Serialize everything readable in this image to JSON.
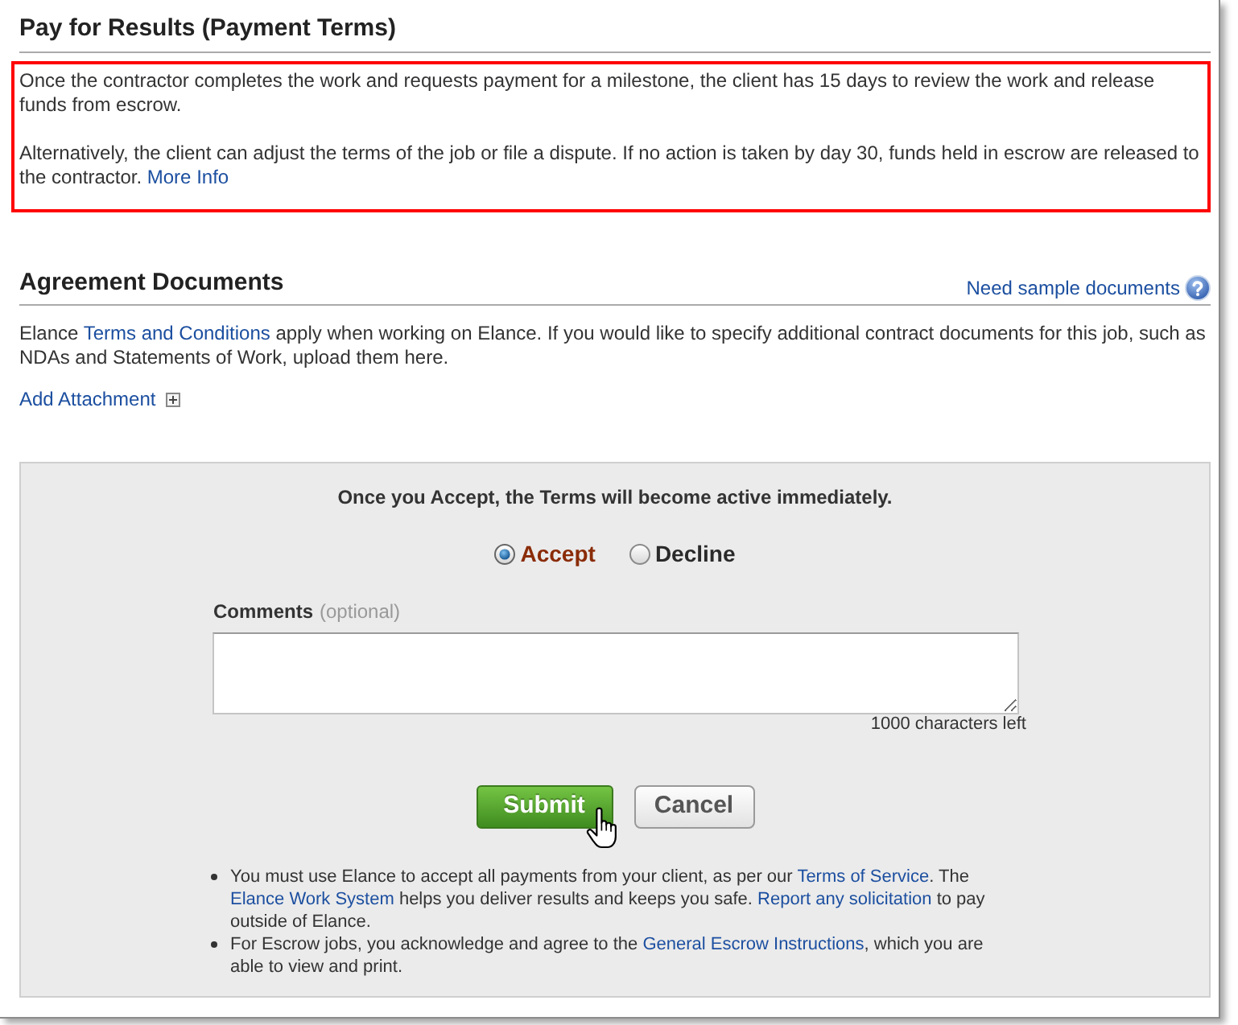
{
  "payment_terms": {
    "title": "Pay for Results (Payment Terms)",
    "paragraphs": [
      [
        {
          "kind": "text",
          "text": "Once the contractor completes the work and requests payment for a milestone, the client has 15 days to review the work and release funds from escrow."
        }
      ],
      [
        {
          "kind": "text",
          "text": "Alternatively, the client can adjust the terms of the job or file a dispute. If no action is taken by day 30, funds held in escrow are released to the contractor. "
        },
        {
          "kind": "link",
          "text": "More Info"
        }
      ]
    ]
  },
  "agreement_documents": {
    "title": "Agreement Documents",
    "help_link": "Need sample documents",
    "paragraph": [
      {
        "kind": "text",
        "text": "Elance "
      },
      {
        "kind": "link",
        "text": "Terms and Conditions"
      },
      {
        "kind": "text",
        "text": " apply when working on Elance. If you would like to specify additional contract documents for this job, such as NDAs and Statements of Work, upload them here."
      }
    ],
    "add_attachment": "Add Attachment"
  },
  "acceptance": {
    "notice": "Once you Accept, the Terms will become active immediately.",
    "choices": [
      {
        "label": "Accept",
        "selected": true
      },
      {
        "label": "Decline",
        "selected": false
      }
    ],
    "comments": {
      "label": "Comments",
      "hint": "(optional)",
      "counter": "1000 characters left"
    },
    "buttons": [
      {
        "label": "Submit",
        "kind": "primary"
      },
      {
        "label": "Cancel",
        "kind": "secondary"
      }
    ],
    "notes": [
      [
        {
          "kind": "text",
          "text": "You must use Elance to accept all payments from your client, as per our "
        },
        {
          "kind": "link",
          "text": "Terms of Service"
        },
        {
          "kind": "text",
          "text": ". The "
        },
        {
          "kind": "link",
          "text": "Elance Work System"
        },
        {
          "kind": "text",
          "text": " helps you deliver results and keeps you safe. "
        },
        {
          "kind": "link",
          "text": "Report any solicitation"
        },
        {
          "kind": "text",
          "text": " to pay outside of Elance."
        }
      ],
      [
        {
          "kind": "text",
          "text": "For Escrow jobs, you acknowledge and agree to the "
        },
        {
          "kind": "link",
          "text": "General Escrow Instructions"
        },
        {
          "kind": "text",
          "text": ", which you are able to view and print."
        }
      ]
    ]
  }
}
